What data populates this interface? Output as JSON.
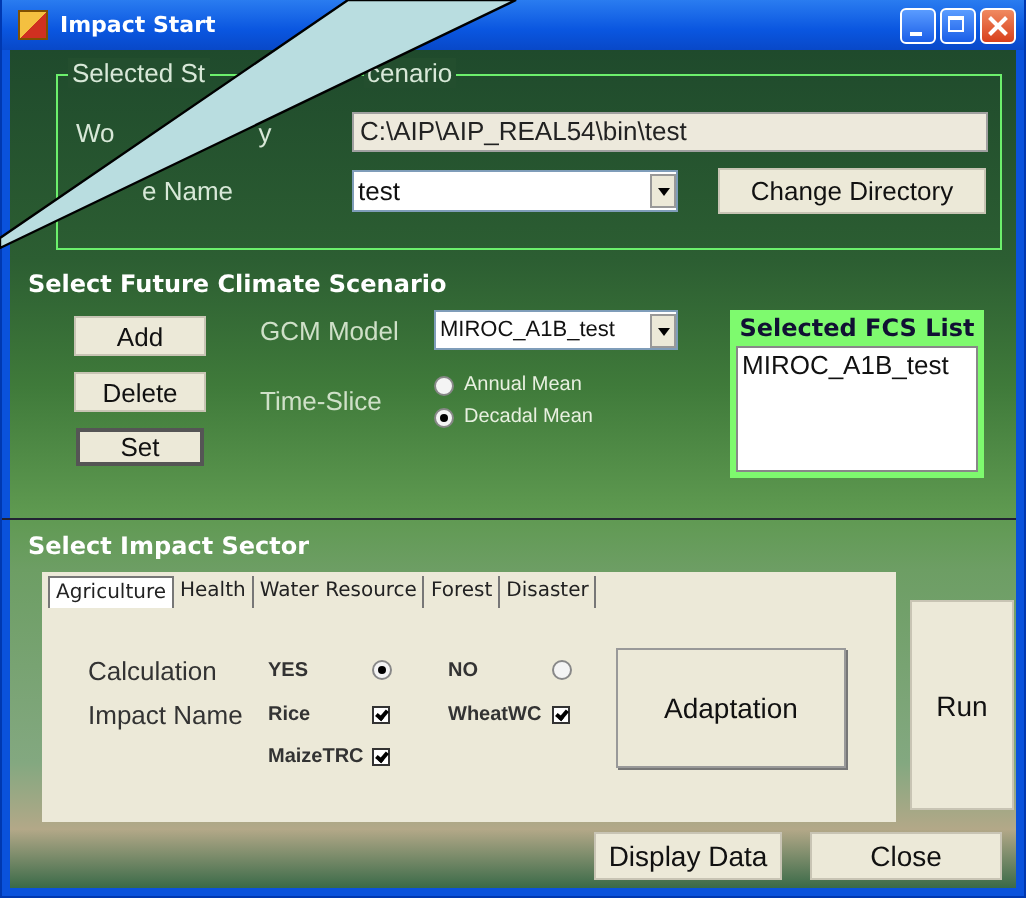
{
  "window": {
    "title": "Impact Start"
  },
  "station_group": {
    "title_parts": [
      "Selected St",
      "cenario"
    ],
    "directory_label_parts": [
      "Wo",
      "y"
    ],
    "directory_value": "C:\\AIP\\AIP_REAL54\\bin\\test",
    "name_label": "e Name",
    "name_value": "test",
    "change_button": "Change Directory"
  },
  "climate_section": {
    "title": "Select Future Climate Scenario",
    "buttons": [
      {
        "label": "Add",
        "focused": false
      },
      {
        "label": "Delete",
        "focused": false
      },
      {
        "label": "Set",
        "focused": true
      }
    ],
    "gcm_label": "GCM Model",
    "gcm_value": "MIROC_A1B_test",
    "time_slice_label": "Time-Slice",
    "time_slice_options": [
      {
        "label": "Annual Mean",
        "selected": false
      },
      {
        "label": "Decadal Mean",
        "selected": true
      }
    ],
    "fcs_list": {
      "title": "Selected FCS List",
      "items": [
        "MIROC_A1B_test"
      ]
    }
  },
  "impact_section": {
    "title": "Select Impact Sector",
    "tabs": [
      {
        "label": "Agriculture",
        "selected": true
      },
      {
        "label": "Health",
        "selected": false
      },
      {
        "label": "Water Resource",
        "selected": false
      },
      {
        "label": "Forest",
        "selected": false
      },
      {
        "label": "Disaster",
        "selected": false
      }
    ],
    "calculation_label": "Calculation",
    "calculation_options": [
      {
        "label": "YES",
        "selected": true
      },
      {
        "label": "NO",
        "selected": false
      }
    ],
    "impact_label": "Impact Name",
    "impacts": [
      {
        "label": "Rice",
        "checked": true
      },
      {
        "label": "WheatWC",
        "checked": true
      },
      {
        "label": "MaizeTRC",
        "checked": true
      }
    ],
    "adaptation_button": "Adaptation",
    "run_button": "Run"
  },
  "footer_buttons": [
    "Display Data",
    "Close"
  ]
}
